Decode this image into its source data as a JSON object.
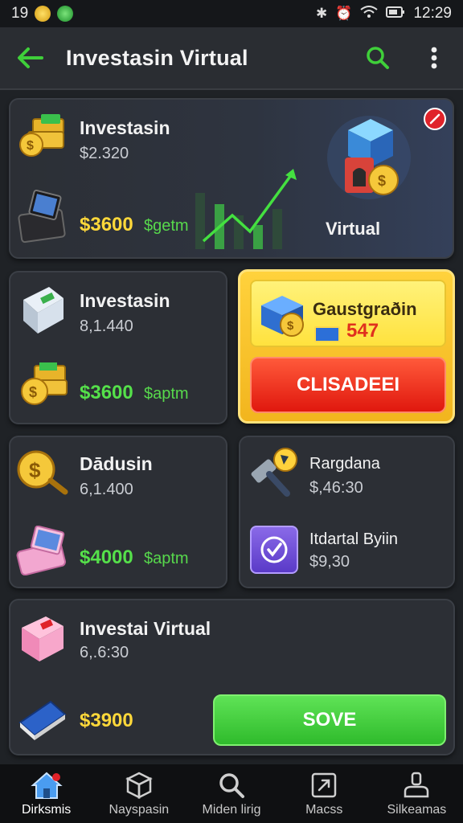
{
  "status": {
    "left_text": "19",
    "time": "12:29"
  },
  "appbar": {
    "title": "Investasin Virtual"
  },
  "hero": {
    "title": "Investasin",
    "subtitle": "$2.320",
    "price": "$3600",
    "unit": "$getm",
    "tag": "Virtual"
  },
  "card2": {
    "title": "Investasin",
    "subtitle": "8,1.440",
    "price": "$3600",
    "unit": "$aptm"
  },
  "promo": {
    "title": "Gaustgraðin",
    "value": "547",
    "button": "CLISADEEI"
  },
  "card3": {
    "title": "Dādusin",
    "subtitle": "6,1.400",
    "price": "$4000",
    "unit": "$aptm"
  },
  "card4": {
    "item1_title": "Rargdana",
    "item1_value": "$,46:30",
    "item2_title": "Itdartal Byiin",
    "item2_value": "$9,30"
  },
  "card5": {
    "title": "Investai Virtual",
    "subtitle": "6,.6:30",
    "price": "$3900",
    "button": "SOVE"
  },
  "nav": [
    {
      "label": "Dirksmis",
      "icon": "home-icon"
    },
    {
      "label": "Nayspasin",
      "icon": "box-icon"
    },
    {
      "label": "Miden lirig",
      "icon": "search-icon"
    },
    {
      "label": "Macss",
      "icon": "external-icon"
    },
    {
      "label": "Silkeamas",
      "icon": "profile-icon"
    }
  ],
  "colors": {
    "price_yellow": "#ffd83a",
    "price_green": "#55e04a",
    "accent_green": "#3fcf3a",
    "claim_red": "#e0180e",
    "promo_yellow": "#ffd23c"
  }
}
